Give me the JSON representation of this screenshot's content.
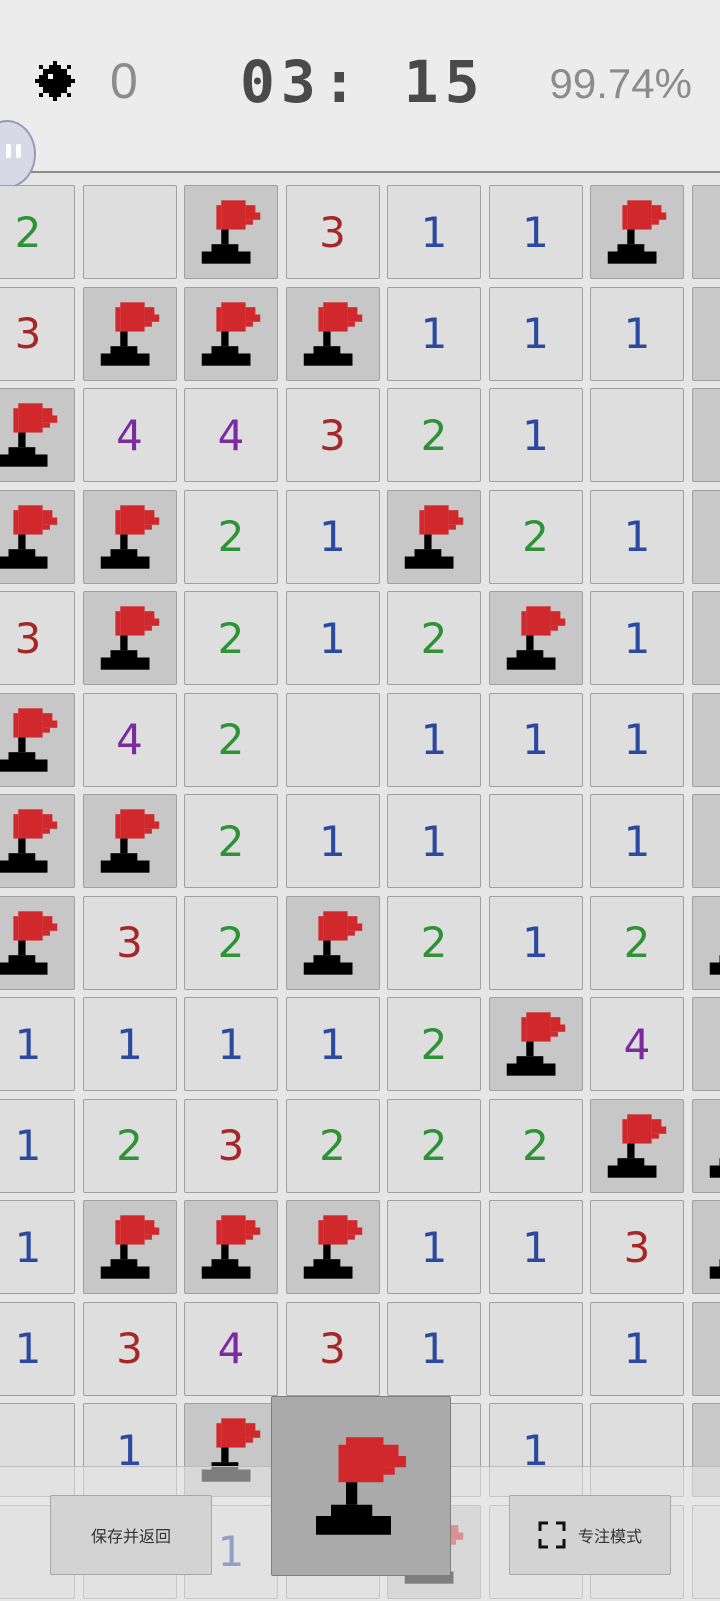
{
  "header": {
    "mine_icon": "mine-icon",
    "flags_placed": "0",
    "timer": "03: 15",
    "progress": "99.74%"
  },
  "colors": {
    "n1": "#2b4a9f",
    "n2": "#2e9237",
    "n3": "#a52727",
    "n4": "#7b2a9f",
    "flag_red": "#d1282c",
    "open_cell": "#dedede",
    "flag_cell": "#c7c7c7"
  },
  "board": {
    "legend": "F = flagged cell, number = revealed count, empty string = revealed blank, H = hidden/unknown",
    "rows": [
      [
        "2",
        "",
        "F",
        "3",
        "1",
        "1",
        "F",
        "H"
      ],
      [
        "3",
        "F",
        "F",
        "F",
        "1",
        "1",
        "1",
        "H"
      ],
      [
        "F",
        "4",
        "4",
        "3",
        "2",
        "1",
        "",
        "H"
      ],
      [
        "F",
        "F",
        "2",
        "1",
        "F",
        "2",
        "1",
        "H"
      ],
      [
        "3",
        "F",
        "2",
        "1",
        "2",
        "F",
        "1",
        "H"
      ],
      [
        "F",
        "4",
        "2",
        "",
        "1",
        "1",
        "1",
        "H"
      ],
      [
        "F",
        "F",
        "2",
        "1",
        "1",
        "",
        "1",
        "H"
      ],
      [
        "F",
        "3",
        "2",
        "F",
        "2",
        "1",
        "2",
        "F"
      ],
      [
        "1",
        "1",
        "1",
        "1",
        "2",
        "F",
        "4",
        "H"
      ],
      [
        "1",
        "2",
        "3",
        "2",
        "2",
        "2",
        "F",
        "F"
      ],
      [
        "1",
        "F",
        "F",
        "F",
        "1",
        "1",
        "3",
        "F"
      ],
      [
        "1",
        "3",
        "4",
        "3",
        "1",
        "",
        "1",
        "H"
      ],
      [
        "",
        "1",
        "F",
        "",
        "",
        "1",
        "",
        "H"
      ],
      [
        "",
        "",
        "1",
        "",
        "F",
        "",
        "",
        ""
      ]
    ]
  },
  "controls": {
    "save_label": "保存并返回",
    "focus_label": "专注模式",
    "mode_icon": "flag-icon"
  }
}
